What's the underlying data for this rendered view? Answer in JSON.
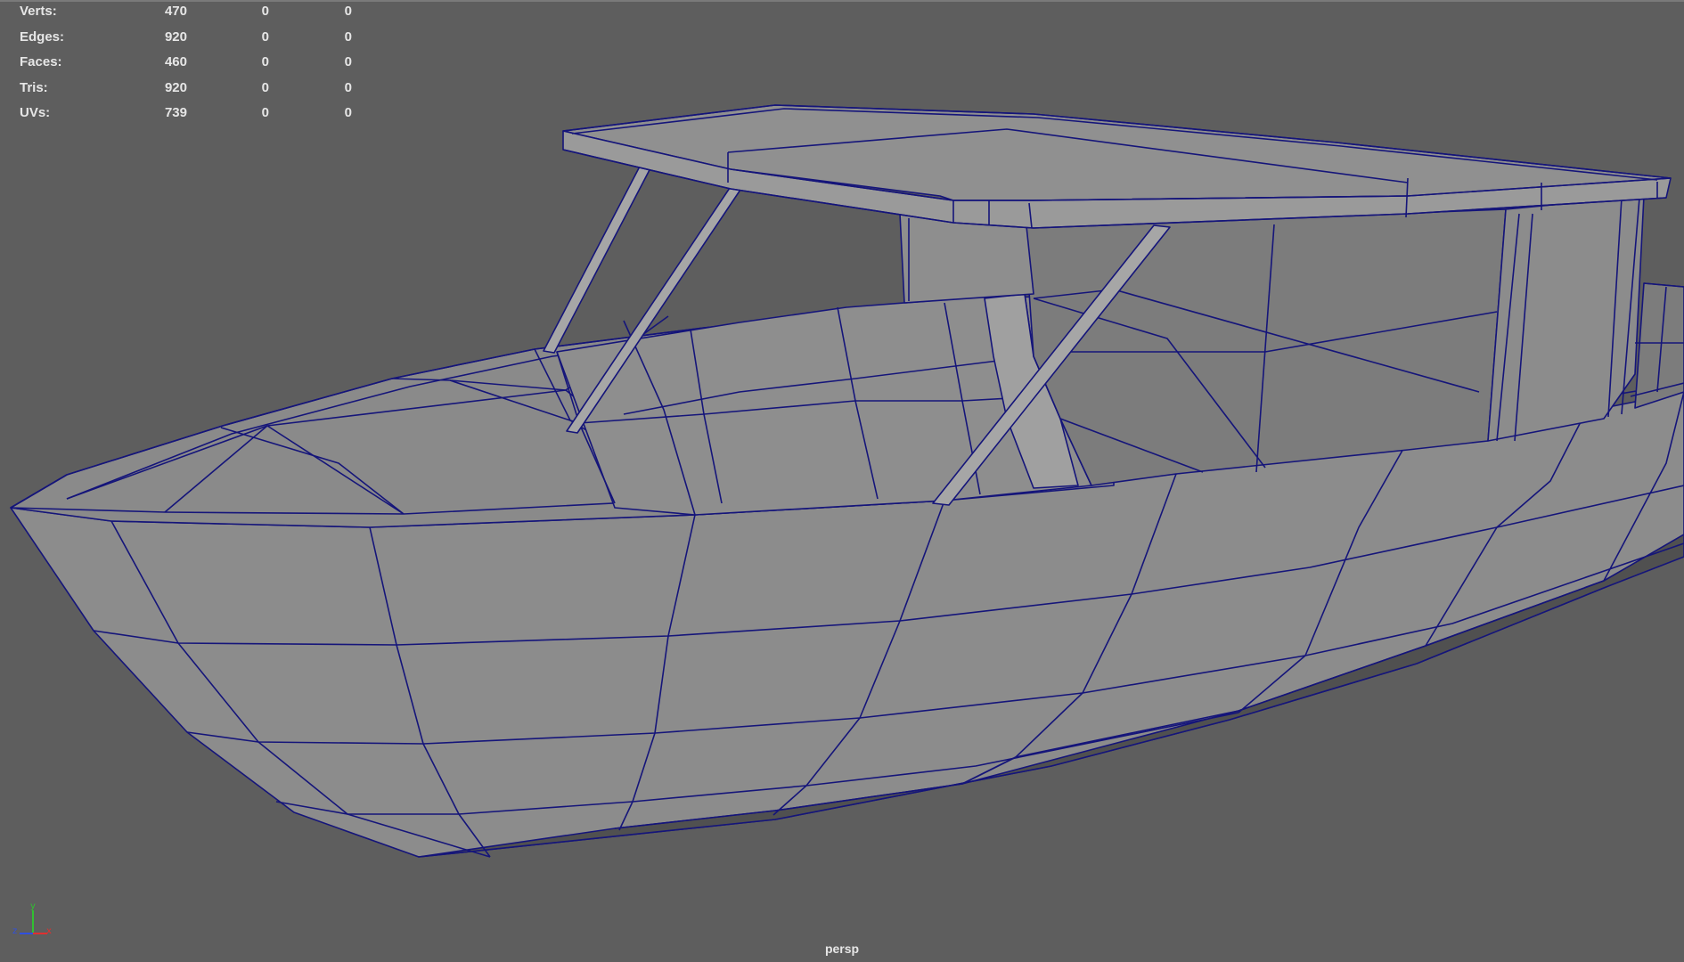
{
  "viewport": {
    "camera": "persp",
    "background_color": "#5e5e5e",
    "wireframe_color": "#15157a",
    "model_shade_color": "#8a8a8a"
  },
  "hud": {
    "rows": [
      {
        "label": "Verts:",
        "v1": "470",
        "v2": "0",
        "v3": "0"
      },
      {
        "label": "Edges:",
        "v1": "920",
        "v2": "0",
        "v3": "0"
      },
      {
        "label": "Faces:",
        "v1": "460",
        "v2": "0",
        "v3": "0"
      },
      {
        "label": "Tris:",
        "v1": "920",
        "v2": "0",
        "v3": "0"
      },
      {
        "label": "UVs:",
        "v1": "739",
        "v2": "0",
        "v3": "0"
      }
    ]
  },
  "axis": {
    "x_label": "x",
    "y_label": "y",
    "z_label": "z",
    "x_color": "#e03030",
    "y_color": "#30c030",
    "z_color": "#3050e0"
  }
}
